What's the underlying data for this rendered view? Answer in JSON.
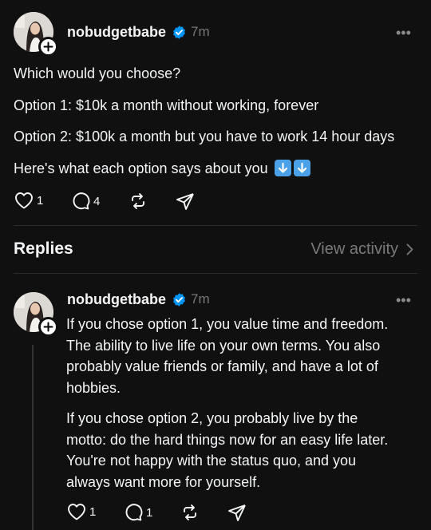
{
  "post": {
    "username": "nobudgetbabe",
    "time": "7m",
    "more": "•••",
    "lines": [
      "Which would you choose?",
      "Option 1: $10k a month without working, forever",
      "Option 2: $100k a month but you have to work 14 hour days",
      "Here's what each option says about you"
    ],
    "likes": "1",
    "comments": "4"
  },
  "replies_section": {
    "title": "Replies",
    "view_activity": "View activity"
  },
  "reply": {
    "username": "nobudgetbabe",
    "time": "7m",
    "more": "•••",
    "paragraph1": [
      "If you chose option 1, you value time and freedom.",
      "The ability to live life on your own terms. You also",
      "probably value friends or family, and have a lot of",
      "hobbies."
    ],
    "paragraph2": [
      "If you chose option 2, you probably live by the",
      "motto: do the hard things now for an easy life later.",
      "You're not happy with the status quo, and you",
      "always want more for yourself."
    ],
    "likes": "1",
    "comments": "1"
  },
  "colors": {
    "background": "#101010",
    "text": "#f3f5f7",
    "muted": "#777777",
    "verified": "#0095f6",
    "emoji_arrow": "#4aa1e8"
  }
}
